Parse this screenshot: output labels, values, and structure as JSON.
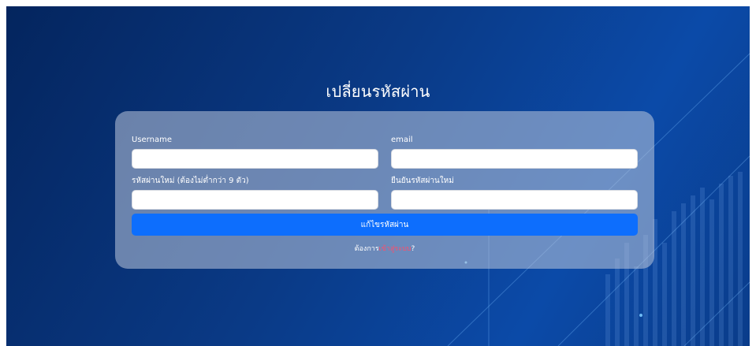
{
  "page": {
    "title": "เปลี่ยนรหัสผ่าน"
  },
  "form": {
    "username_label": "Username",
    "email_label": "email",
    "new_password_label": "รหัสผ่านใหม่ (ต้องไม่ต่ำกว่า 9 ตัว)",
    "confirm_password_label": "ยืนยันรหัสผ่านใหม่",
    "username_value": "",
    "email_value": "",
    "new_password_value": "",
    "confirm_password_value": "",
    "submit_label": "แก้ไขรหัสผ่าน",
    "login_prefix": "ต้องการ",
    "login_link": "เข้าสู่ระบบ",
    "login_suffix": "?"
  },
  "colors": {
    "background_dark": "#04255e",
    "background_light": "#0b4aa8",
    "button": "#0d6efd",
    "link": "#ff4d6a"
  }
}
